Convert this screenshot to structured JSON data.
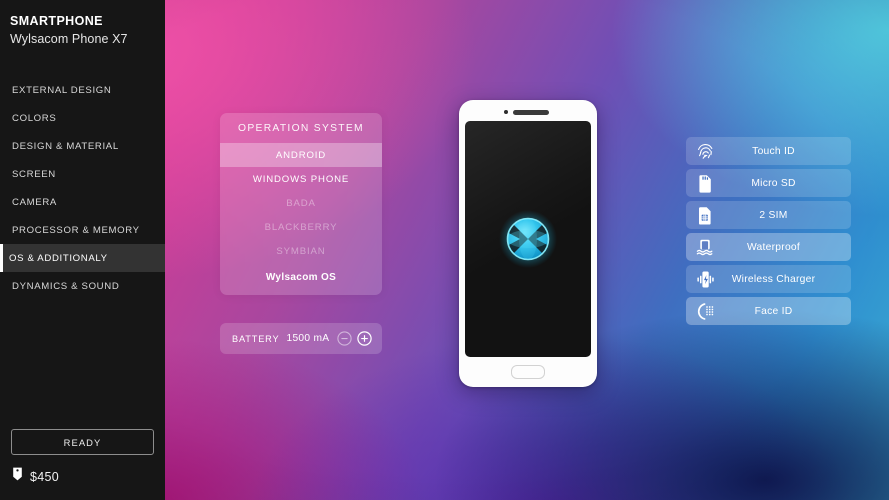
{
  "sidebar": {
    "brand_title": "SMARTPHONE",
    "brand_subtitle": "Wylsacom Phone X7",
    "nav_items": [
      {
        "label": "EXTERNAL DESIGN",
        "active": false
      },
      {
        "label": "COLORS",
        "active": false
      },
      {
        "label": "DESIGN & MATERIAL",
        "active": false
      },
      {
        "label": "SCREEN",
        "active": false
      },
      {
        "label": "CAMERA",
        "active": false
      },
      {
        "label": "PROCESSOR & MEMORY",
        "active": false
      },
      {
        "label": "OS & ADDITIONALY",
        "active": true
      },
      {
        "label": "DYNAMICS & SOUND",
        "active": false
      }
    ],
    "ready_button": "READY",
    "price": "$450",
    "price_icon": "price-tag-icon"
  },
  "os_panel": {
    "title": "OPERATION SYSTEM",
    "options": [
      {
        "label": "ANDROID",
        "state": "selected"
      },
      {
        "label": "WINDOWS PHONE",
        "state": "available"
      },
      {
        "label": "BADA",
        "state": "disabled"
      },
      {
        "label": "BLACKBERRY",
        "state": "disabled"
      },
      {
        "label": "SYMBIAN",
        "state": "disabled"
      },
      {
        "label": "Wylsacom OS",
        "state": "custom"
      }
    ]
  },
  "battery": {
    "label": "BATTERY",
    "value": "1500 mA",
    "decrease_icon": "minus-circle-icon",
    "increase_icon": "plus-circle-icon"
  },
  "phone": {
    "camera_icon": "front-camera-icon",
    "speaker_icon": "earpiece-speaker-icon",
    "home_button_icon": "home-button-icon",
    "logo_icon": "wylsacom-sphere-logo-icon"
  },
  "features": [
    {
      "label": "Touch ID",
      "icon": "fingerprint-icon",
      "active": false
    },
    {
      "label": "Micro SD",
      "icon": "sd-card-icon",
      "active": false
    },
    {
      "label": "2 SIM",
      "icon": "sim-card-icon",
      "active": false
    },
    {
      "label": "Waterproof",
      "icon": "waterproof-icon",
      "active": true
    },
    {
      "label": "Wireless Charger",
      "icon": "wireless-charger-icon",
      "active": false
    },
    {
      "label": "Face ID",
      "icon": "face-id-icon",
      "active": true
    }
  ],
  "colors": {
    "sidebar_bg": "#161616",
    "sidebar_active_bg": "#333333",
    "accent_pink": "#e2449b",
    "accent_cyan": "#3fb9de",
    "accent_violet": "#5f20aa",
    "panel_overlay": "rgba(255,255,255,0.17)",
    "logo_glow": "#3fd6f0"
  }
}
